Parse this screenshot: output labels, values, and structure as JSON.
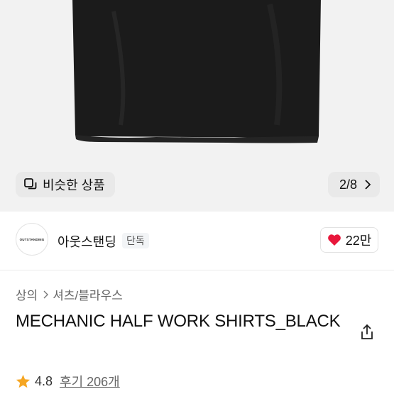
{
  "product_image": {
    "similar_button_label": "비슷한 상품",
    "pager_text": "2/8"
  },
  "brand": {
    "logo_text": "OUTSTANDING",
    "name": "아웃스탠딩",
    "badge": "단독",
    "like_count": "22만"
  },
  "breadcrumb": {
    "category": "상의",
    "subcategory": "셔츠/블라우스"
  },
  "product": {
    "title": "MECHANIC HALF WORK SHIRTS_BLACK"
  },
  "rating": {
    "score": "4.8",
    "reviews_label": "후기 206개"
  },
  "colors": {
    "heart": "#e8173b",
    "star": "#f5a623"
  }
}
